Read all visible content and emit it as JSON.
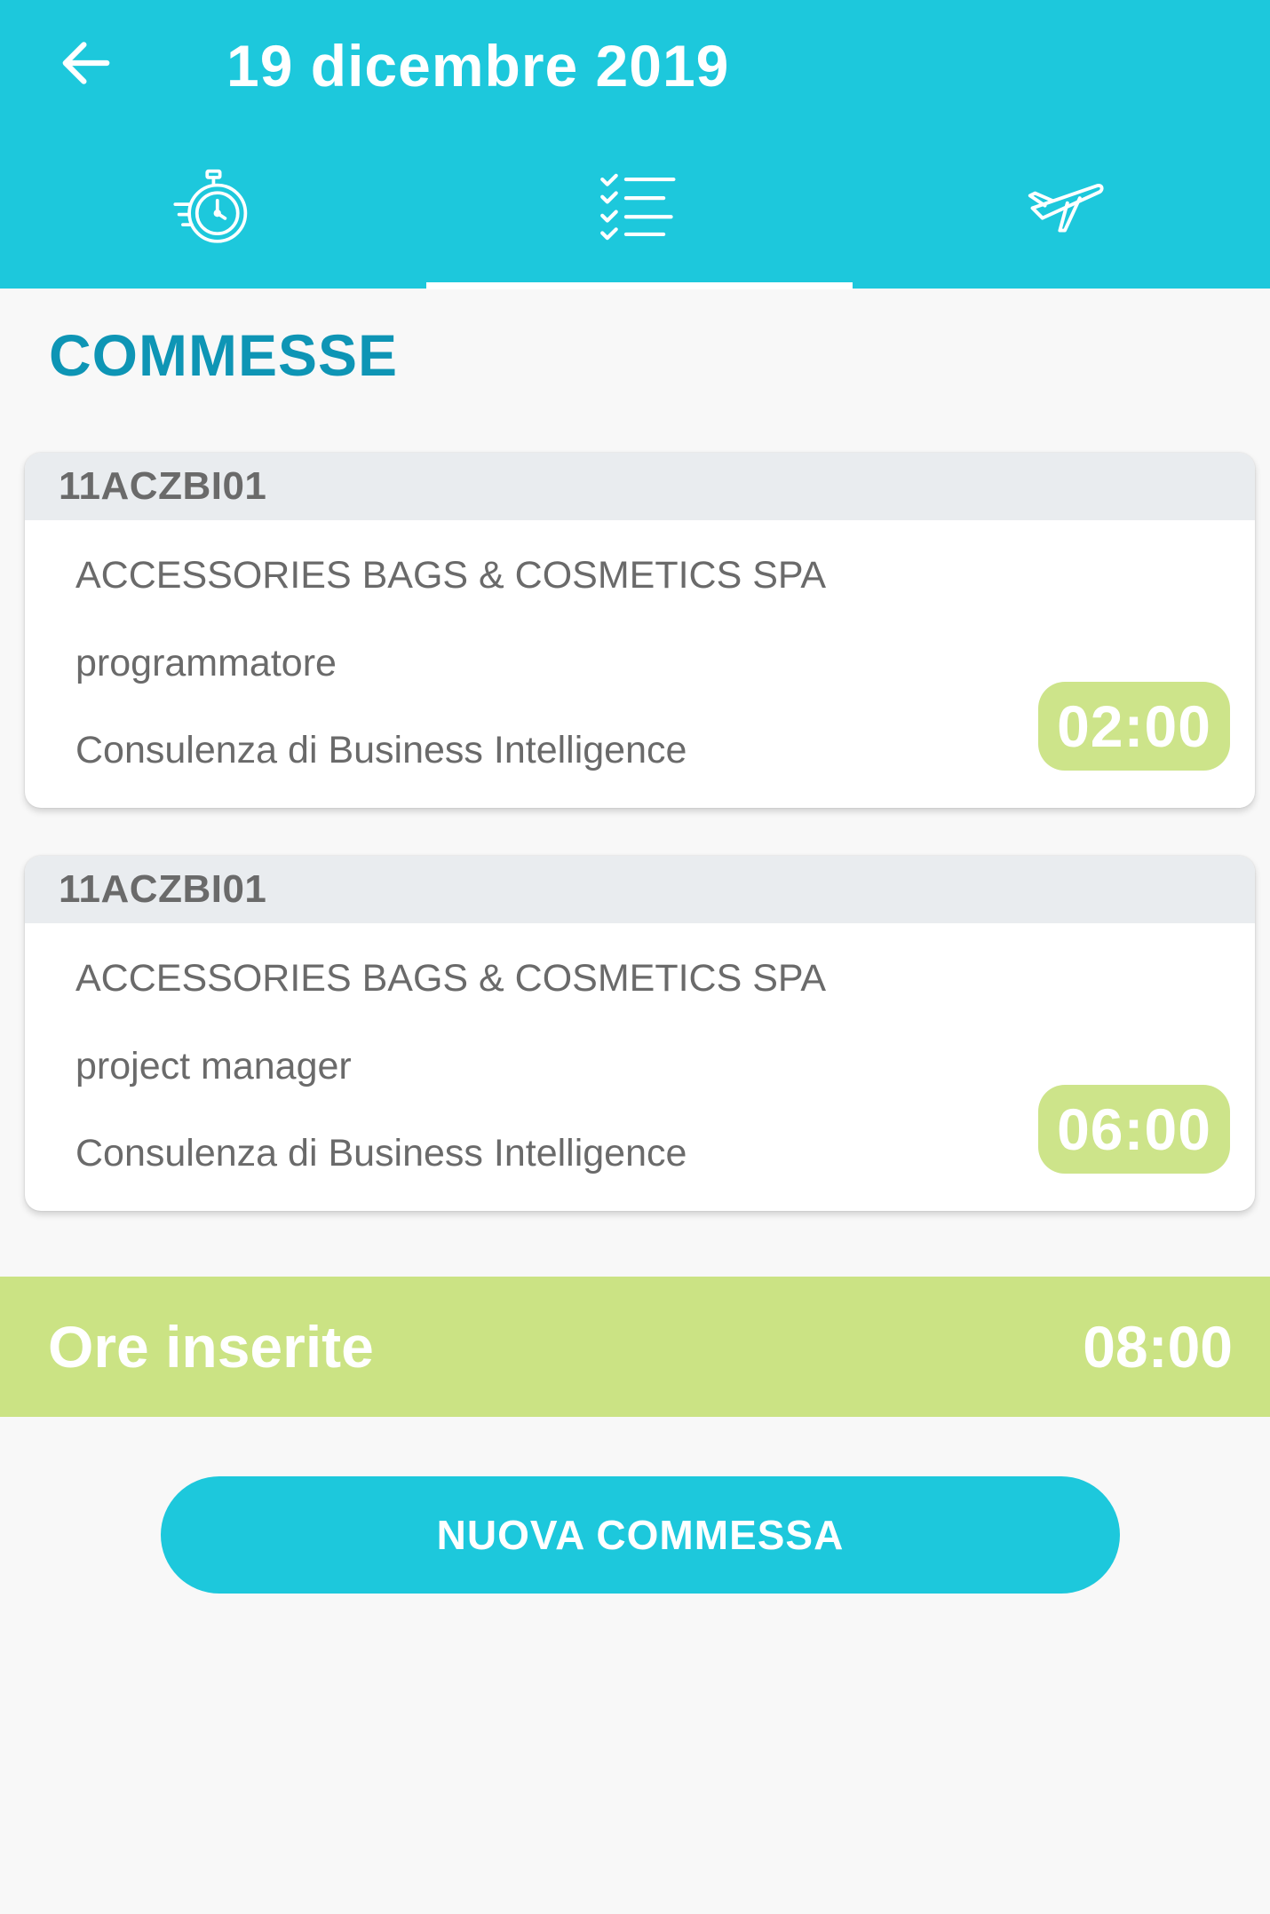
{
  "header": {
    "title": "19 dicembre 2019",
    "back_icon": "arrow-left-icon"
  },
  "tabs": [
    {
      "icon": "stopwatch-icon",
      "active": false
    },
    {
      "icon": "checklist-icon",
      "active": true
    },
    {
      "icon": "airplane-icon",
      "active": false
    }
  ],
  "section": {
    "title": "COMMESSE"
  },
  "entries": [
    {
      "code": "11ACZBI01",
      "client": "ACCESSORIES BAGS & COSMETICS SPA",
      "role": "programmatore",
      "activity": "Consulenza di Business Intelligence",
      "hours": "02:00"
    },
    {
      "code": "11ACZBI01",
      "client": "ACCESSORIES BAGS & COSMETICS SPA",
      "role": "project manager",
      "activity": "Consulenza di Business Intelligence",
      "hours": "06:00"
    }
  ],
  "totals": {
    "label": "Ore inserite",
    "value": "08:00"
  },
  "actions": {
    "new_label": "NUOVA COMMESSA"
  },
  "colors": {
    "primary": "#1dc8dc",
    "accent_title": "#0e95b5",
    "hours_green": "#cde48a",
    "totals_green": "#cbe384",
    "card_header": "#e9ecef",
    "background": "#f8f8f8"
  }
}
